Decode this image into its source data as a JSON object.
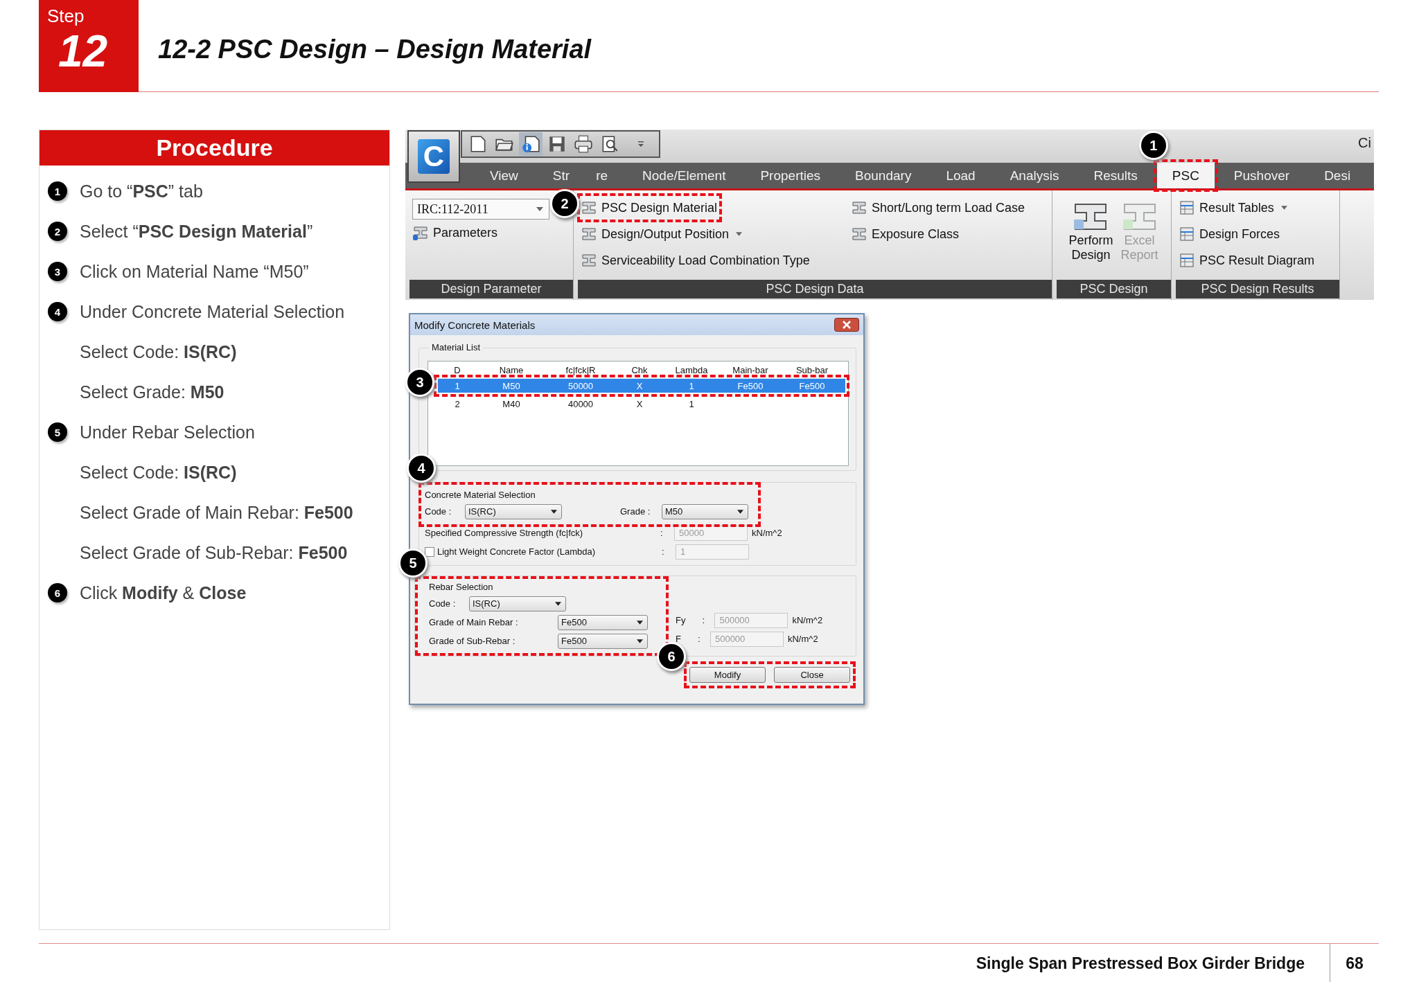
{
  "header": {
    "step_label": "Step",
    "step_number": "12",
    "title": "12-2 PSC Design – Design Material"
  },
  "procedure": {
    "title": "Procedure",
    "items": [
      {
        "kind": "step",
        "number": "1",
        "text": "Go to “**PSC**” tab"
      },
      {
        "kind": "step",
        "number": "2",
        "text": "Select “**PSC Design Material**”"
      },
      {
        "kind": "step",
        "number": "3",
        "text": "Click on Material Name “M50”"
      },
      {
        "kind": "step",
        "number": "4",
        "text": "Under Concrete Material Selection"
      },
      {
        "kind": "sub",
        "text": "Select Code: **IS(RC)**"
      },
      {
        "kind": "sub",
        "text": "Select Grade: **M50**"
      },
      {
        "kind": "step",
        "number": "5",
        "text": "Under Rebar Selection"
      },
      {
        "kind": "sub",
        "text": "Select Code: **IS(RC)**"
      },
      {
        "kind": "sub",
        "text": "Select Grade of Main Rebar: **Fe500**"
      },
      {
        "kind": "sub",
        "text": "Select Grade of Sub-Rebar: **Fe500**"
      },
      {
        "kind": "step",
        "number": "6",
        "text": "Click **Modify** & **Close**"
      }
    ]
  },
  "app": {
    "logo_letter": "C",
    "title_fragment": "Ci",
    "tabs": [
      {
        "label": "View",
        "selected": false
      },
      {
        "label": "Str",
        "label_end": "re",
        "selected": false
      },
      {
        "label": "Node/Element",
        "selected": false
      },
      {
        "label": "Properties",
        "selected": false
      },
      {
        "label": "Boundary",
        "selected": false
      },
      {
        "label": "Load",
        "selected": false
      },
      {
        "label": "Analysis",
        "selected": false
      },
      {
        "label": "Results",
        "selected": false
      },
      {
        "label": "PSC",
        "selected": true
      },
      {
        "label": "Pushover",
        "selected": false
      },
      {
        "label": "Desi",
        "selected": false
      }
    ],
    "design_parameter": {
      "title": "Design Parameter",
      "dropdown": "IRC:112-2011",
      "button": "Parameters"
    },
    "psc_design_data": {
      "title": "PSC Design Data",
      "items": [
        {
          "label": "PSC Design Material",
          "has_menu": false
        },
        {
          "label": "Design/Output Position",
          "has_menu": true
        },
        {
          "label": "Serviceability Load Combination Type",
          "has_menu": false
        }
      ],
      "items_2": [
        {
          "label": "Short/Long term Load Case",
          "has_menu": false
        },
        {
          "label": "Exposure Class",
          "has_menu": false
        }
      ]
    },
    "psc_design": {
      "title": "PSC Design",
      "buttons": [
        {
          "lines": [
            "Perform",
            "Design"
          ],
          "disabled": false
        },
        {
          "lines": [
            "Excel",
            "Report"
          ],
          "disabled": true
        }
      ]
    },
    "psc_design_results": {
      "title": "PSC Design Results",
      "items": [
        {
          "label": "Result Tables",
          "has_menu": true
        },
        {
          "label": "Design Forces",
          "has_menu": false
        },
        {
          "label": "PSC Result Diagram",
          "has_menu": false
        }
      ]
    }
  },
  "dialog": {
    "title": "Modify Concrete Materials",
    "material_list": {
      "title": "Material List",
      "columns": [
        "D",
        "Name",
        "fc|fck|R",
        "Chk",
        "Lambda",
        "Main-bar",
        "Sub-bar"
      ],
      "rows": [
        {
          "selected": true,
          "cells": [
            "1",
            "M50",
            "50000",
            "X",
            "1",
            "Fe500",
            "Fe500"
          ]
        },
        {
          "selected": false,
          "cells": [
            "2",
            "M40",
            "40000",
            "X",
            "1"
          ]
        }
      ]
    },
    "concrete": {
      "title": "Concrete Material Selection",
      "code_label": "Code :",
      "code": "IS(RC)",
      "grade_label": "Grade :",
      "grade": "M50",
      "strength_label": "Specified Compressive Strength (fc|fck)",
      "strength_colon": ":",
      "strength": "50000",
      "strength_unit": "kN/m^2",
      "lambda_label": "Light Weight Concrete Factor (Lambda)",
      "lambda_checked": false,
      "lambda_colon": ":",
      "lambda": "1"
    },
    "rebar": {
      "title": "Rebar Selection",
      "code_label": "Code :",
      "code": "IS(RC)",
      "main_label": "Grade of Main Rebar :",
      "main": "Fe500",
      "sub_label": "Grade of Sub-Rebar :",
      "sub": "Fe500",
      "fy_label": "Fy",
      "fy_colon": ":",
      "fy": "500000",
      "fy_unit": "kN/m^2",
      "fs_label": "F",
      "fs_colon": ":",
      "fs": "500000",
      "fs_unit": "kN/m^2"
    },
    "buttons": [
      "Modify",
      "Close"
    ]
  },
  "callouts": [
    {
      "number": "1"
    },
    {
      "number": "2"
    },
    {
      "number": "3"
    },
    {
      "number": "4"
    },
    {
      "number": "5"
    },
    {
      "number": "6"
    }
  ],
  "footer": {
    "title": "Single Span Prestressed Box Girder Bridge",
    "page": "68"
  }
}
